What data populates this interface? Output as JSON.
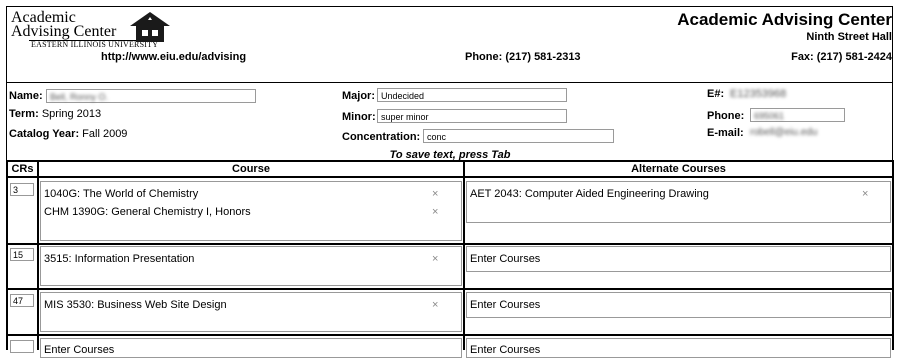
{
  "logo": {
    "line1": "Academic",
    "line2": "Advising Center",
    "line3": "EASTERN ILLINOIS UNIVERSITY"
  },
  "header": {
    "title": "Academic Advising Center",
    "building": "Ninth Street Hall",
    "website": "http://www.eiu.edu/advising",
    "phone": "Phone: (217) 581-2313",
    "fax": "Fax: (217) 581-2424"
  },
  "student": {
    "name_label": "Name:",
    "name_value": "Bell, Ronny O.",
    "term_label": "Term:",
    "term_value": "Spring 2013",
    "catalog_label": "Catalog Year:",
    "catalog_value": "Fall 2009",
    "major_label": "Major:",
    "major_value": "Undecided",
    "minor_label": "Minor:",
    "minor_value": "super minor",
    "concentration_label": "Concentration:",
    "concentration_value": "conc",
    "eid_label": "E#:",
    "eid_value": "E12353968",
    "phone_label": "Phone:",
    "phone_value": "695061",
    "email_label": "E-mail:",
    "email_value": "robell@eiu.edu"
  },
  "save_note": "To save text, press Tab",
  "table": {
    "headers": {
      "crs": "CRs",
      "course": "Course",
      "alternate": "Alternate Courses"
    },
    "rows": [
      {
        "crs": "3",
        "courses": [
          "1040G: The World of Chemistry",
          "CHM 1390G: General Chemistry I, Honors"
        ],
        "alternates": [
          "AET 2043: Computer Aided Engineering Drawing"
        ]
      },
      {
        "crs": "15",
        "courses": [
          "3515: Information Presentation"
        ],
        "alternate_placeholder": "Enter Courses"
      },
      {
        "crs": "47",
        "courses": [
          "MIS 3530: Business Web Site Design"
        ],
        "alternate_placeholder": "Enter Courses"
      },
      {
        "crs": "",
        "course_placeholder": "Enter Courses",
        "alternate_placeholder": "Enter Courses"
      }
    ],
    "remove_icon": "×"
  }
}
